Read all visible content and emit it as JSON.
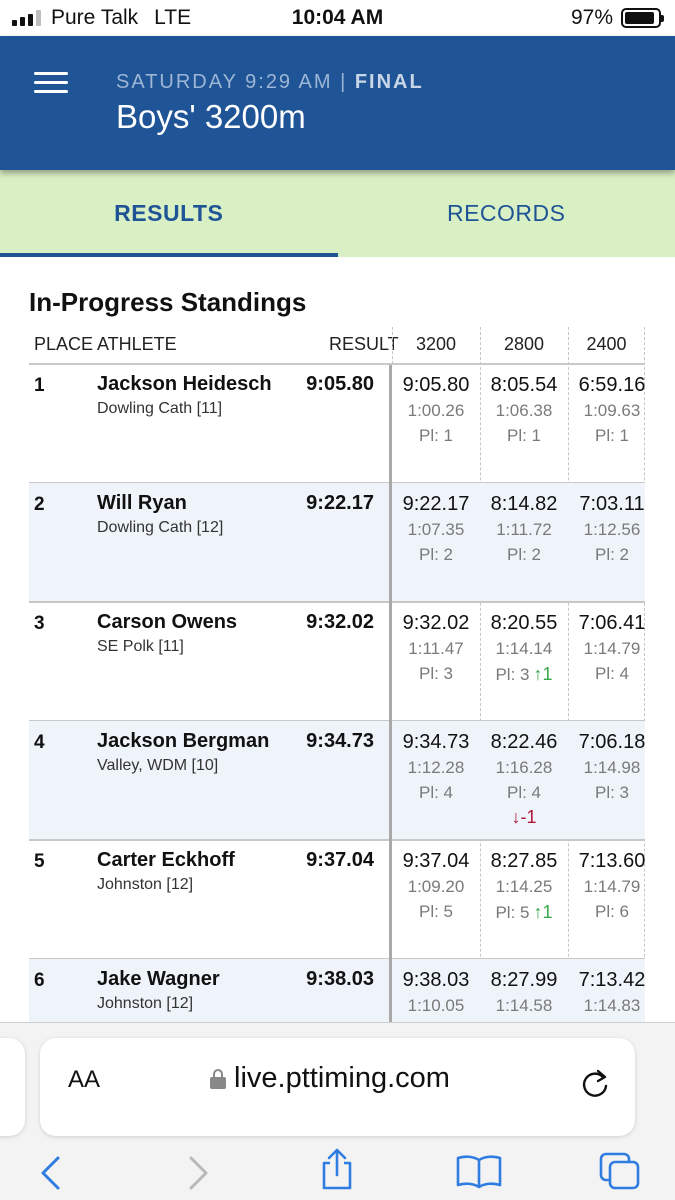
{
  "status_bar": {
    "carrier": "Pure Talk",
    "network": "LTE",
    "time": "10:04 AM",
    "battery": "97%"
  },
  "header": {
    "day_time": "SATURDAY 9:29 AM",
    "separator": "|",
    "status": "FINAL",
    "title": "Boys' 3200m"
  },
  "tabs": [
    {
      "label": "RESULTS",
      "active": true
    },
    {
      "label": "RECORDS",
      "active": false
    }
  ],
  "standings": {
    "title": "In-Progress Standings",
    "columns": {
      "place": "PLACE",
      "athlete": "ATHLETE",
      "result": "RESULT",
      "splits": [
        "3200",
        "2800",
        "2400"
      ]
    },
    "rows": [
      {
        "place": "1",
        "name": "Jackson Heidesch",
        "team": "Dowling Cath [11]",
        "result": "9:05.80",
        "splits": [
          {
            "time": "9:05.80",
            "lap": "1:00.26",
            "pl": "Pl: 1",
            "change": ""
          },
          {
            "time": "8:05.54",
            "lap": "1:06.38",
            "pl": "Pl: 1",
            "change": ""
          },
          {
            "time": "6:59.16",
            "lap": "1:09.63",
            "pl": "Pl: 1",
            "change": ""
          }
        ]
      },
      {
        "place": "2",
        "name": "Will Ryan",
        "team": "Dowling Cath [12]",
        "result": "9:22.17",
        "splits": [
          {
            "time": "9:22.17",
            "lap": "1:07.35",
            "pl": "Pl: 2",
            "change": ""
          },
          {
            "time": "8:14.82",
            "lap": "1:11.72",
            "pl": "Pl: 2",
            "change": ""
          },
          {
            "time": "7:03.11",
            "lap": "1:12.56",
            "pl": "Pl: 2",
            "change": ""
          }
        ]
      },
      {
        "place": "3",
        "name": "Carson Owens",
        "team": "SE Polk [11]",
        "result": "9:32.02",
        "splits": [
          {
            "time": "9:32.02",
            "lap": "1:11.47",
            "pl": "Pl: 3",
            "change": ""
          },
          {
            "time": "8:20.55",
            "lap": "1:14.14",
            "pl": "Pl: 3",
            "change": "↑1"
          },
          {
            "time": "7:06.41",
            "lap": "1:14.79",
            "pl": "Pl: 4",
            "change": ""
          }
        ]
      },
      {
        "place": "4",
        "name": "Jackson Bergman",
        "team": "Valley, WDM [10]",
        "result": "9:34.73",
        "splits": [
          {
            "time": "9:34.73",
            "lap": "1:12.28",
            "pl": "Pl: 4",
            "change": ""
          },
          {
            "time": "8:22.46",
            "lap": "1:16.28",
            "pl": "Pl: 4",
            "change": "↓-1"
          },
          {
            "time": "7:06.18",
            "lap": "1:14.98",
            "pl": "Pl: 3",
            "change": ""
          }
        ]
      },
      {
        "place": "5",
        "name": "Carter Eckhoff",
        "team": "Johnston [12]",
        "result": "9:37.04",
        "splits": [
          {
            "time": "9:37.04",
            "lap": "1:09.20",
            "pl": "Pl: 5",
            "change": ""
          },
          {
            "time": "8:27.85",
            "lap": "1:14.25",
            "pl": "Pl: 5",
            "change": "↑1"
          },
          {
            "time": "7:13.60",
            "lap": "1:14.79",
            "pl": "Pl: 6",
            "change": ""
          }
        ]
      },
      {
        "place": "6",
        "name": "Jake Wagner",
        "team": "Johnston [12]",
        "result": "9:38.03",
        "splits": [
          {
            "time": "9:38.03",
            "lap": "1:10.05",
            "pl": "",
            "change": ""
          },
          {
            "time": "8:27.99",
            "lap": "1:14.58",
            "pl": "",
            "change": ""
          },
          {
            "time": "7:13.42",
            "lap": "1:14.83",
            "pl": "",
            "change": ""
          }
        ]
      }
    ]
  },
  "browser": {
    "text_size": "AA",
    "url": "live.pttiming.com"
  },
  "icons": [
    "hamburger-icon",
    "lock-icon",
    "reload-icon",
    "back-icon",
    "forward-icon",
    "share-icon",
    "bookmarks-icon",
    "tabs-icon"
  ],
  "colors": {
    "header": "#1f5596",
    "tabs_bg": "#d9efc4",
    "alt_row": "#eef4fa",
    "up": "#3aa84a",
    "down": "#b0153c"
  }
}
